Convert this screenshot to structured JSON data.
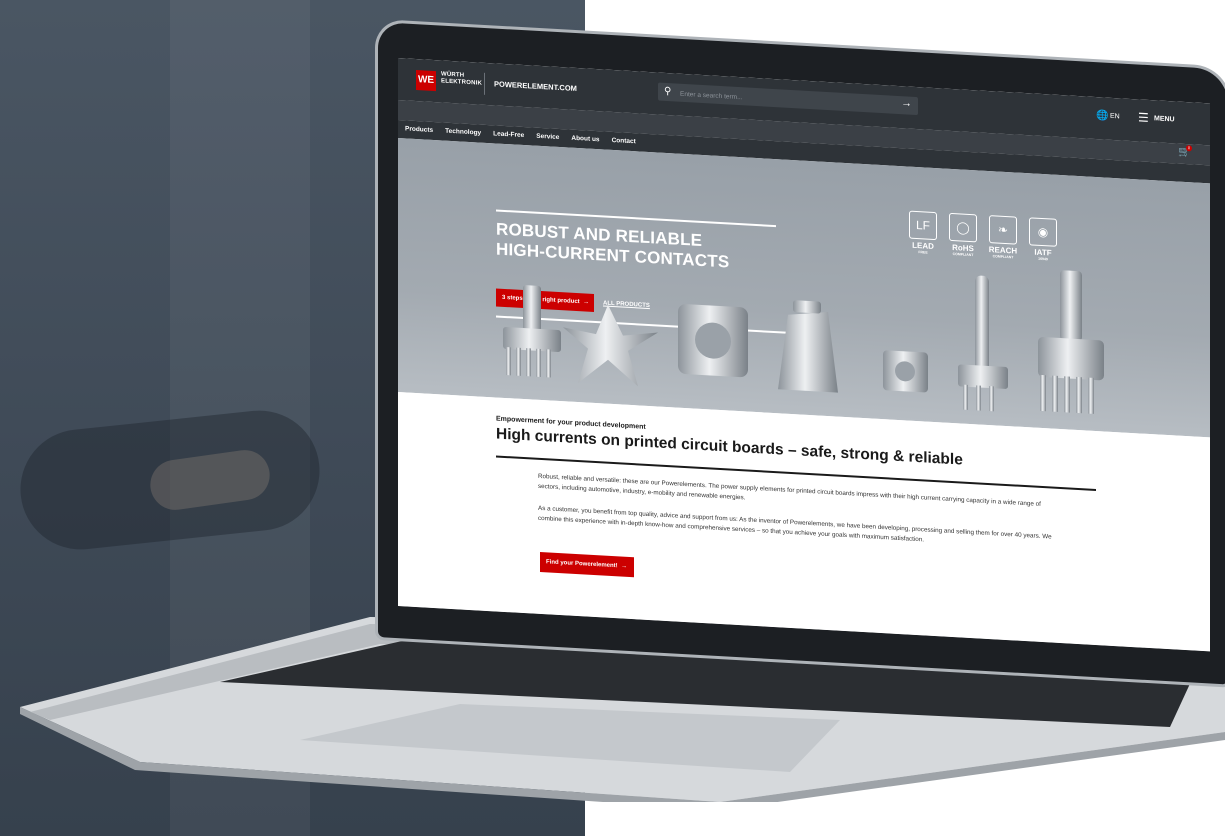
{
  "header": {
    "logo_mark": "WE",
    "logo_line1": "WÜRTH",
    "logo_line2": "ELEKTRONIK",
    "site_name": "POWERELEMENT.COM",
    "search_placeholder": "Enter a search term...",
    "language": "EN",
    "menu_label": "MENU",
    "cart_count": "0"
  },
  "nav": {
    "items": [
      {
        "label": "Products"
      },
      {
        "label": "Technology"
      },
      {
        "label": "Lead-Free"
      },
      {
        "label": "Service"
      },
      {
        "label": "About us"
      },
      {
        "label": "Contact"
      }
    ]
  },
  "hero": {
    "title_line1": "ROBUST AND RELIABLE",
    "title_line2": "HIGH-CURRENT CONTACTS",
    "cta_label": "3 steps to the right product",
    "all_products_label": "ALL PRODUCTS",
    "badges": [
      {
        "icon": "LF",
        "name": "LEAD",
        "sub": "FREE"
      },
      {
        "icon": "",
        "name": "RoHS",
        "sub": "COMPLIANT"
      },
      {
        "icon": "",
        "name": "REACH",
        "sub": "COMPLIANT"
      },
      {
        "icon": "",
        "name": "IATF",
        "sub": "16949"
      }
    ]
  },
  "content": {
    "eyebrow": "Empowerment for your product development",
    "headline": "High currents on printed circuit boards – safe, strong & reliable",
    "paragraph1": "Robust, reliable and versatile: these are our Powerelements. The power supply elements for printed circuit boards impress with their high current carrying capacity in a wide range of sectors, including automotive, industry, e-mobility and renewable energies.",
    "paragraph2": "As a customer, you benefit from top quality, advice and support from us: As the inventor of Powerelements, we have been developing, processing and selling them for over 40 years. We combine this experience with in-depth know-how and comprehensive services – so that you achieve your goals with maximum satisfaction.",
    "cta_label": "Find your Powerelement!"
  },
  "colors": {
    "brand_red": "#cc0000",
    "header_dark": "#2e3338",
    "hero_gray": "#9ea6ad"
  }
}
